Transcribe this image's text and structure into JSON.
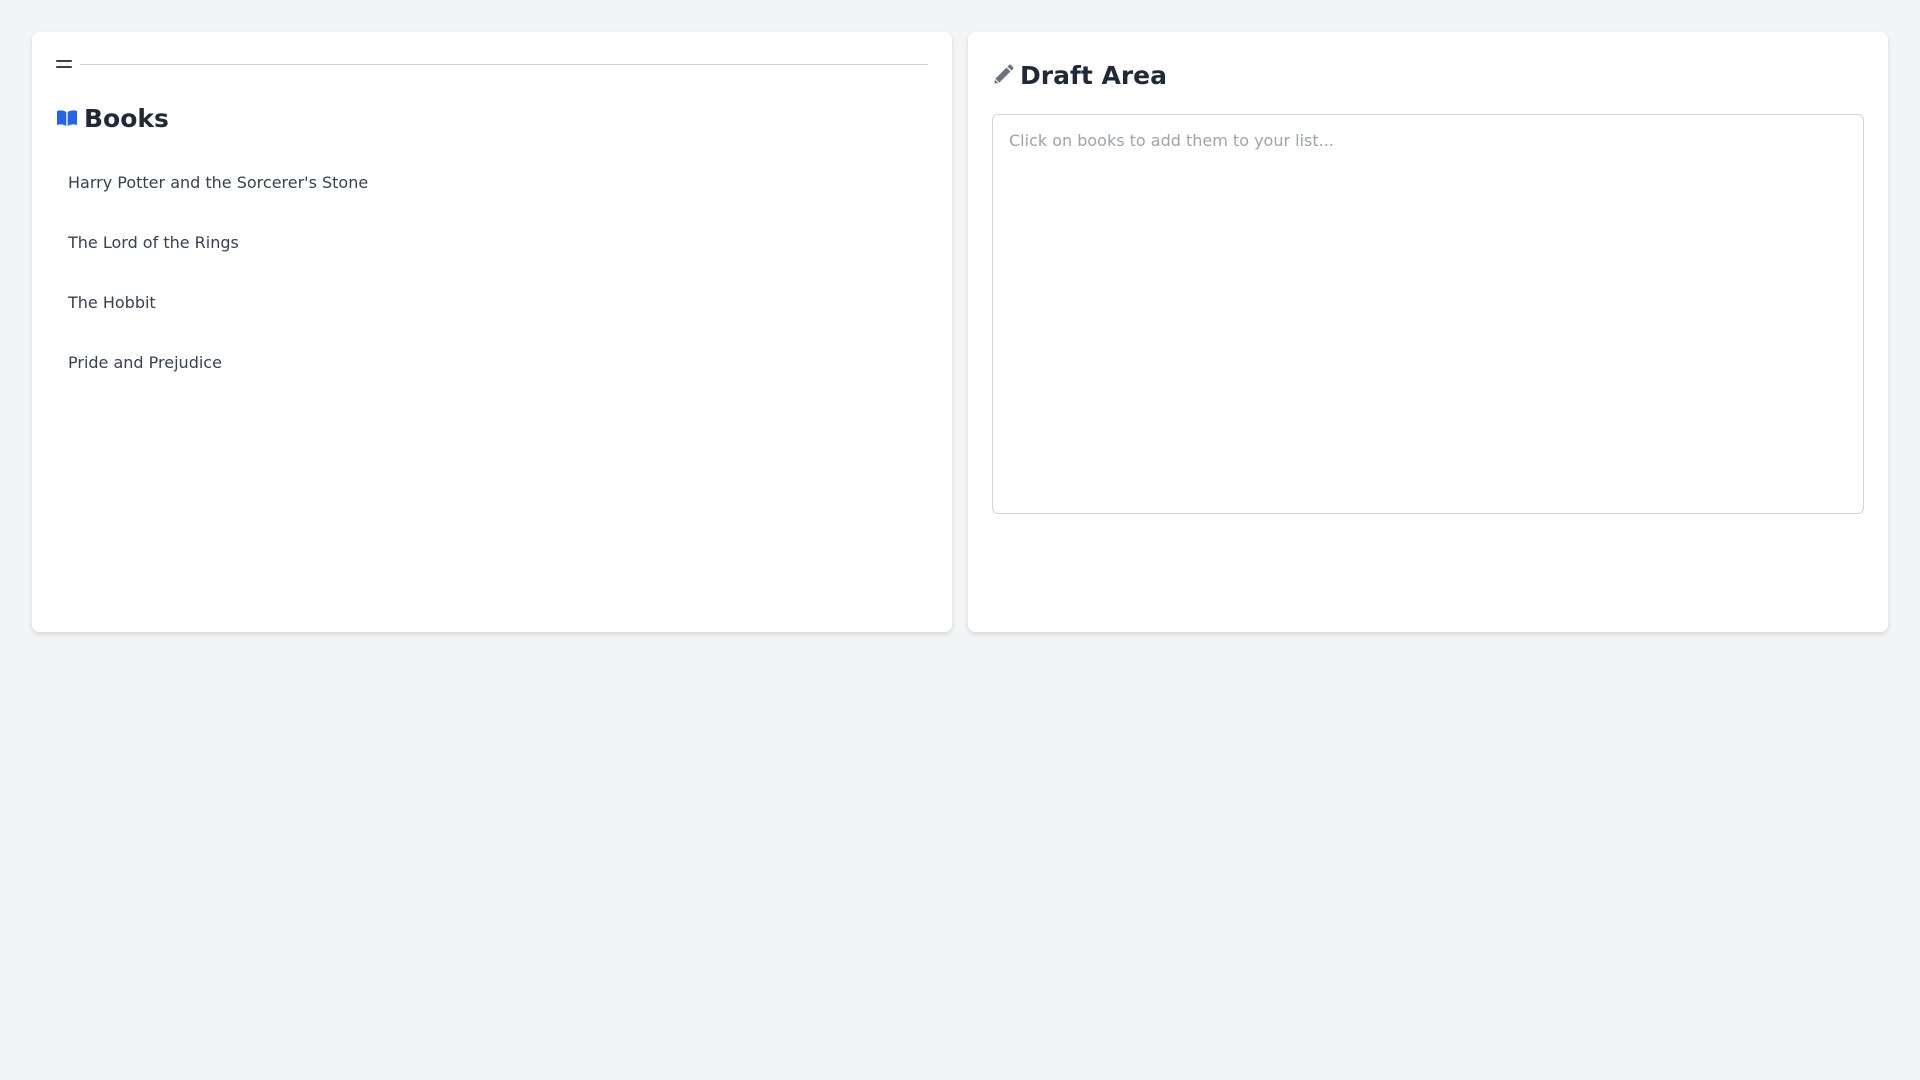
{
  "books_panel": {
    "title": "Books",
    "items": [
      {
        "label": "Harry Potter and the Sorcerer's Stone"
      },
      {
        "label": "The Lord of the Rings"
      },
      {
        "label": "The Hobbit"
      },
      {
        "label": "Pride and Prejudice"
      }
    ],
    "icon": "open-book-icon",
    "icon_color": "#2563eb"
  },
  "draft_panel": {
    "title": "Draft Area",
    "icon": "pencil-icon",
    "icon_color": "#6b7280",
    "textarea": {
      "value": "",
      "placeholder": "Click on books to add them to your list..."
    }
  },
  "colors": {
    "background": "#f3f4f6",
    "panel": "#ffffff",
    "text": "#1f2937",
    "accent": "#2563eb"
  }
}
